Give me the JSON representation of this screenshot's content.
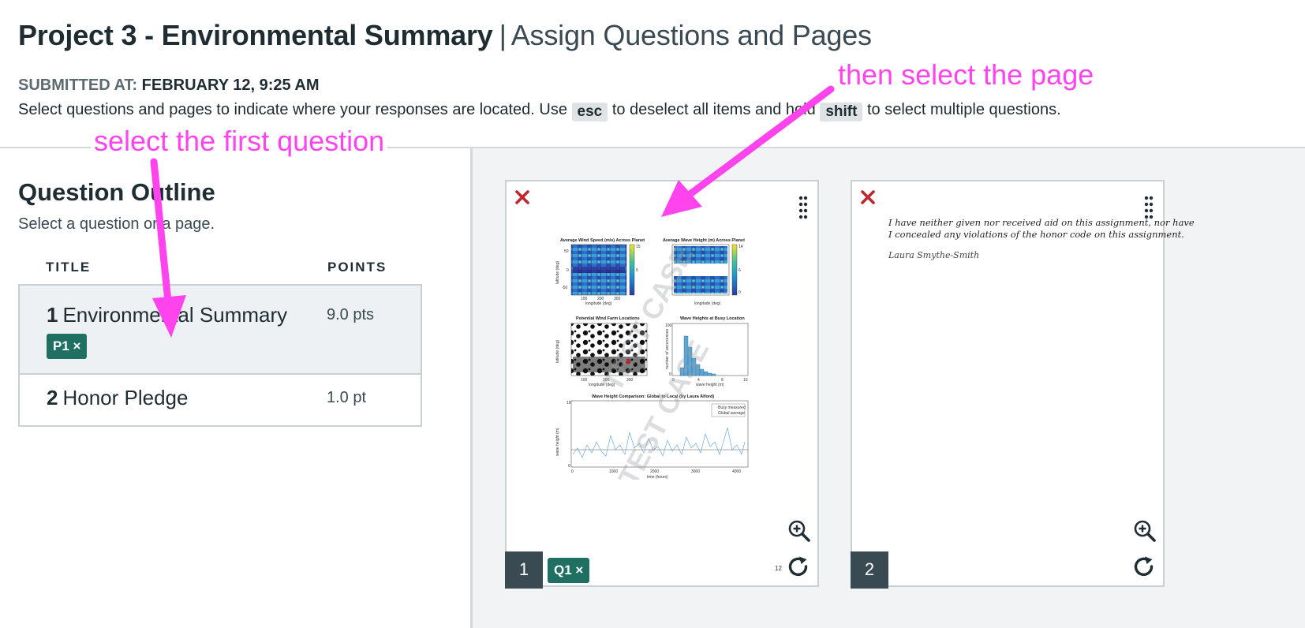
{
  "header": {
    "title": "Project 3 - Environmental Summary",
    "separator": "|",
    "subtitle": "Assign Questions and Pages",
    "submitted_label": "SUBMITTED AT:",
    "submitted_value": "FEBRUARY 12, 9:25 AM",
    "instruction_1": "Select questions and pages to indicate where your responses are located. Use",
    "key_esc": "esc",
    "instruction_2": "to deselect all items and hold",
    "key_shift": "shift",
    "instruction_3": "to select multiple questions."
  },
  "outline": {
    "title": "Question Outline",
    "subtitle": "Select a question or a page.",
    "col_title": "TITLE",
    "col_points": "POINTS",
    "questions": [
      {
        "num": "1",
        "name": "Environmental Summary",
        "points": "9.0 pts",
        "tag": "P1 ×"
      },
      {
        "num": "2",
        "name": "Honor Pledge",
        "points": "1.0 pt"
      }
    ]
  },
  "pages": [
    {
      "num": "1",
      "tag": "Q1 ×",
      "corner_num": "12",
      "plots": {
        "p1_title": "Average Wind Speed (m/s) Across Planet",
        "p2_title": "Average Wave Height (m) Across Planet",
        "p3_title": "Potential Wind Farm Locations",
        "p4_title": "Wave Heights at Busy Location",
        "p5_title": "Wave Height Comparison: Global to Local (by Laura Alford)",
        "lon_label": "longitude (deg)",
        "lat_label": "latitude (deg)",
        "wave_label": "wave height (m)",
        "count_label": "number of occurrences",
        "time_label": "time (hours)",
        "legend_busy": "Busy measured",
        "legend_global": "Global average",
        "watermark": "TEST CASE"
      }
    },
    {
      "num": "2",
      "pledge_line_1": "I have neither given nor received aid on this assignment, nor have",
      "pledge_line_2": "I concealed any violations of the honor code on this assignment.",
      "signature": "Laura Smythe-Smith"
    }
  ],
  "annotations": {
    "first": "select the first question",
    "second": "then select the page"
  },
  "colors": {
    "accent_green": "#1f6f63",
    "annotation_magenta": "#ff44ee",
    "remove_red": "#c0262d",
    "page_number_bg": "#3a4a52"
  },
  "icons": [
    "close-x-icon",
    "drag-handle-icon",
    "zoom-in-icon",
    "rotate-icon"
  ]
}
